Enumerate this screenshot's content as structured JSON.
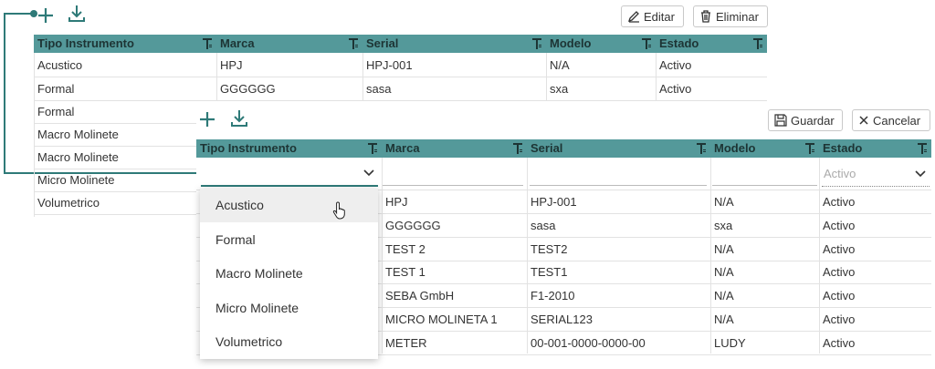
{
  "colors": {
    "accent": "#54999a",
    "icon": "#2e7a78",
    "connector": "#2e7a78"
  },
  "back_toolbar": {
    "add_icon": "plus-icon",
    "download_icon": "download-icon",
    "edit_label": "Editar",
    "delete_label": "Eliminar"
  },
  "back_grid": {
    "columns": [
      "Tipo Instrumento",
      "Marca",
      "Serial",
      "Modelo",
      "Estado"
    ],
    "rows": [
      [
        "Acustico",
        "HPJ",
        "HPJ-001",
        "N/A",
        "Activo"
      ],
      [
        "Formal",
        "GGGGGG",
        "sasa",
        "sxa",
        "Activo"
      ]
    ],
    "left_list": [
      "Formal",
      "Macro Molinete",
      "Macro Molinete",
      "Micro Molinete",
      "Volumetrico"
    ]
  },
  "front_toolbar": {
    "add_icon": "plus-icon",
    "download_icon": "download-icon",
    "save_label": "Guardar",
    "cancel_label": "Cancelar"
  },
  "front_grid": {
    "columns": [
      "Tipo Instrumento",
      "Marca",
      "Serial",
      "Modelo",
      "Estado"
    ],
    "filter_placeholder": "Activo",
    "rows": [
      [
        "HPJ",
        "HPJ-001",
        "N/A",
        "Activo"
      ],
      [
        "GGGGGG",
        "sasa",
        "sxa",
        "Activo"
      ],
      [
        "TEST 2",
        "TEST2",
        "N/A",
        "Activo"
      ],
      [
        "TEST 1",
        "TEST1",
        "N/A",
        "Activo"
      ],
      [
        "SEBA GmbH",
        "F1-2010",
        "N/A",
        "Activo"
      ],
      [
        "MICRO MOLINETA 1",
        "SERIAL123",
        "N/A",
        "Activo"
      ],
      [
        "METER",
        "00-001-0000-0000-00",
        "LUDY",
        "Activo"
      ]
    ]
  },
  "dropdown": {
    "options": [
      "Acustico",
      "Formal",
      "Macro Molinete",
      "Micro Molinete",
      "Volumetrico"
    ],
    "hovered": "Acustico"
  }
}
